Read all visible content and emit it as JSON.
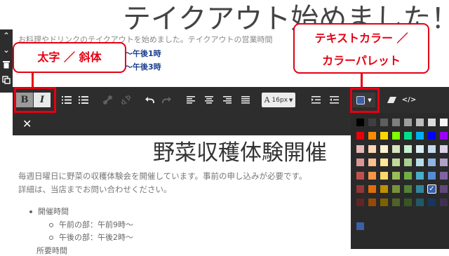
{
  "page": {
    "big_title": "テイクアウト始めました！",
    "intro_text": "お料理やドリンクのテイクアウトを始めました。テイクアウトの営業時間",
    "time_pm1": "〜午後1時",
    "time_pm3": "〜午後3時",
    "heading": "野菜収穫体験開催",
    "para1": "毎週日曜日に野菜の収穫体験会を開催しています。事前の申し込みが必要です。",
    "para2": "詳細は、当店までお問い合わせください。",
    "list_item": "開催時間",
    "sub_am": "午前の部：午前9時〜",
    "sub_pm": "午後の部：午後2時〜",
    "cut_item": "所要時間"
  },
  "toolbar": {
    "bold": "B",
    "italic": "I",
    "font_size": "16px",
    "font_size_prefix": "A",
    "close": "✕"
  },
  "callouts": {
    "bold_italic": "太字 ／ 斜体",
    "text_color_line1": "テキストカラー ／",
    "text_color_line2": "カラーパレット"
  },
  "palette": {
    "selected_color": "#3b5fa8",
    "selected_check": "✓",
    "colors": [
      [
        "#000000",
        "#3f3f3f",
        "#5e5e5e",
        "#7f7f7f",
        "#9e9e9e",
        "#bdbdbd",
        "#dcdcdc",
        "#f5f5f5",
        "#ffffff"
      ],
      [
        "#e8000b",
        "#ff8c00",
        "#ffd700",
        "#7fff00",
        "#00e08a",
        "#00b0f0",
        "#0000ff",
        "#9900ff",
        "#ff00ff"
      ],
      [
        "#e6b8b7",
        "#fcd5b4",
        "#fff2cc",
        "#d8e4bc",
        "#c6efce",
        "#daeef3",
        "#c5d9f1",
        "#d9d2e9",
        "#f2dcdb"
      ],
      [
        "#da9694",
        "#fabf8f",
        "#ffe699",
        "#c4d79b",
        "#a9d08e",
        "#b7dee8",
        "#8db4e2",
        "#b1a0c7",
        "#e6b9b8"
      ],
      [
        "#c0504d",
        "#f79646",
        "#ffd966",
        "#9bbb59",
        "#70ad47",
        "#4bacc6",
        "#538dd5",
        "#8064a2",
        "#d99795"
      ],
      [
        "#953734",
        "#e26b0a",
        "#bf9000",
        "#76933c",
        "#548235",
        "#31869b",
        "#3b5fa8",
        "#60497a",
        "#963634"
      ],
      [
        "#632523",
        "#974806",
        "#7f6000",
        "#4f6228",
        "#375623",
        "#215967",
        "#17375e",
        "#3f3151",
        "#632523"
      ]
    ]
  }
}
